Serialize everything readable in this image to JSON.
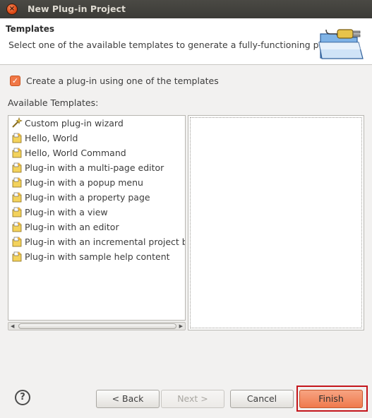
{
  "window": {
    "title": "New Plug-in Project",
    "close_glyph": "×"
  },
  "header": {
    "title": "Templates",
    "description": "Select one of the available templates to generate a fully-functioning plug-in."
  },
  "checkbox": {
    "label": "Create a plug-in using one of the templates",
    "checked": true,
    "glyph": "✓"
  },
  "templates": {
    "label": "Available Templates:",
    "items": [
      {
        "label": "Custom plug-in wizard",
        "icon": "custom-wizard-icon"
      },
      {
        "label": "Hello, World",
        "icon": "template-icon"
      },
      {
        "label": "Hello, World Command",
        "icon": "template-icon"
      },
      {
        "label": "Plug-in with a multi-page editor",
        "icon": "template-icon"
      },
      {
        "label": "Plug-in with a popup menu",
        "icon": "template-icon"
      },
      {
        "label": "Plug-in with a property page",
        "icon": "template-icon"
      },
      {
        "label": "Plug-in with a view",
        "icon": "template-icon"
      },
      {
        "label": "Plug-in with an editor",
        "icon": "template-icon"
      },
      {
        "label": "Plug-in with an incremental project builder",
        "icon": "template-icon"
      },
      {
        "label": "Plug-in with sample help content",
        "icon": "template-icon"
      }
    ]
  },
  "buttons": {
    "help": "?",
    "back": "< Back",
    "next": "Next >",
    "cancel": "Cancel",
    "finish": "Finish"
  },
  "colors": {
    "accent": "#f07746",
    "focus": "#c4161c",
    "titlebar": "#3c3b37"
  }
}
